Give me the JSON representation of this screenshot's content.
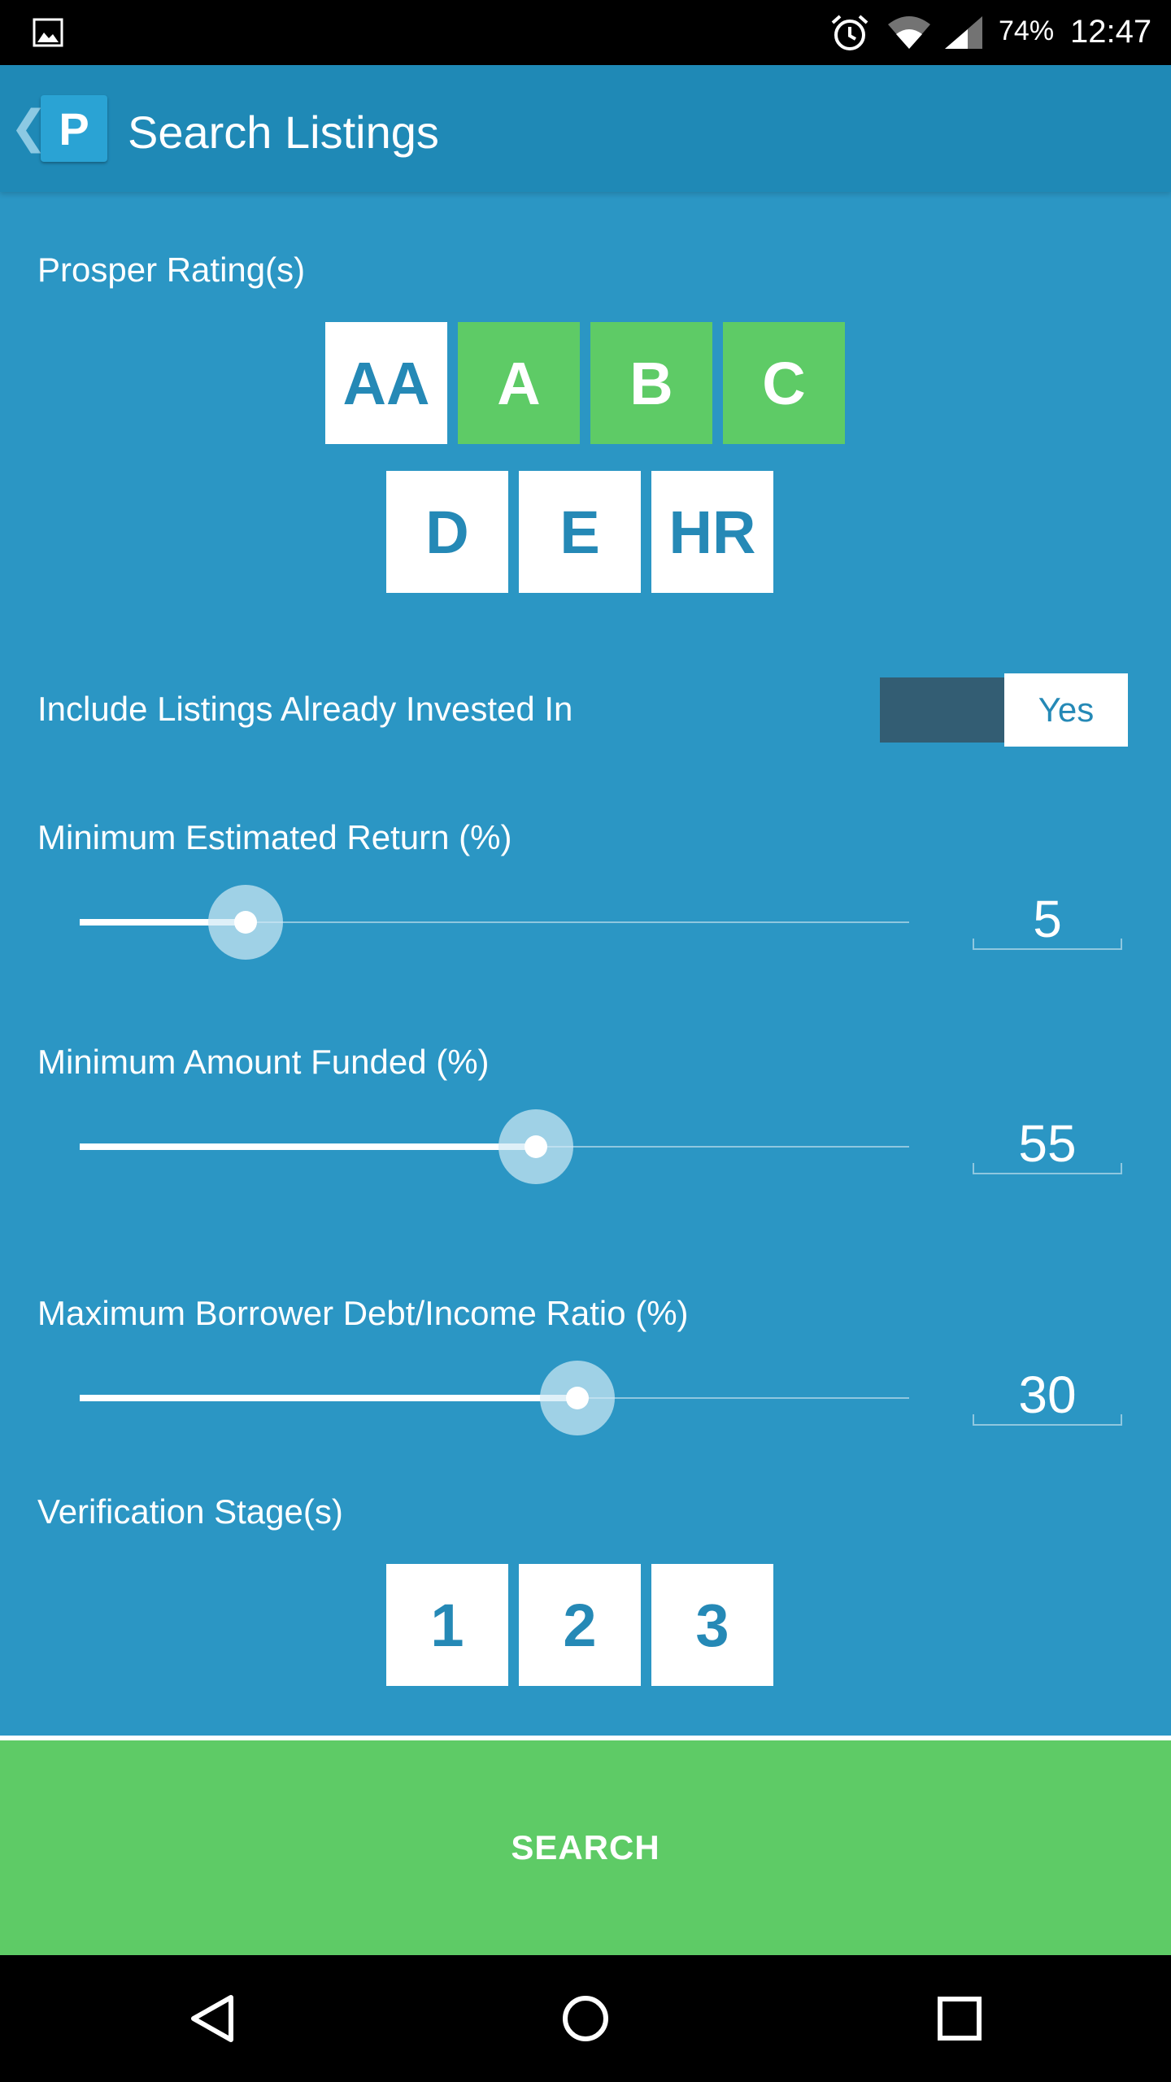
{
  "status_bar": {
    "battery": "74%",
    "time": "12:47",
    "icons": [
      "gallery-icon",
      "alarm-icon",
      "wifi-icon",
      "signal-icon"
    ]
  },
  "app_bar": {
    "back_glyph": "❮",
    "logo_letter": "P",
    "title": "Search Listings"
  },
  "ratings": {
    "label": "Prosper Rating(s)",
    "tiles": [
      {
        "label": "AA",
        "selected": false
      },
      {
        "label": "A",
        "selected": true
      },
      {
        "label": "B",
        "selected": true
      },
      {
        "label": "C",
        "selected": true
      },
      {
        "label": "D",
        "selected": false
      },
      {
        "label": "E",
        "selected": false
      },
      {
        "label": "HR",
        "selected": false
      }
    ]
  },
  "invested": {
    "label": "Include Listings Already Invested In",
    "toggle_text": "Yes"
  },
  "min_return": {
    "label": "Minimum Estimated Return (%)",
    "value": "5",
    "slider_fraction": 0.2
  },
  "min_funded": {
    "label": "Minimum Amount Funded (%)",
    "value": "55",
    "slider_fraction": 0.55
  },
  "max_dti": {
    "label": "Maximum Borrower Debt/Income Ratio (%)",
    "value": "30",
    "slider_fraction": 0.6
  },
  "verification": {
    "label": "Verification Stage(s)",
    "tiles": [
      {
        "label": "1",
        "selected": false
      },
      {
        "label": "2",
        "selected": false
      },
      {
        "label": "3",
        "selected": false
      }
    ]
  },
  "search_label": "SEARCH",
  "colors": {
    "background": "#2b96c4",
    "app_bar": "#1f89b6",
    "tile_selected": "#5ecb66",
    "tile_unselected": "#ffffff",
    "tile_text": "#2589b6",
    "toggle_track": "#335d73"
  }
}
